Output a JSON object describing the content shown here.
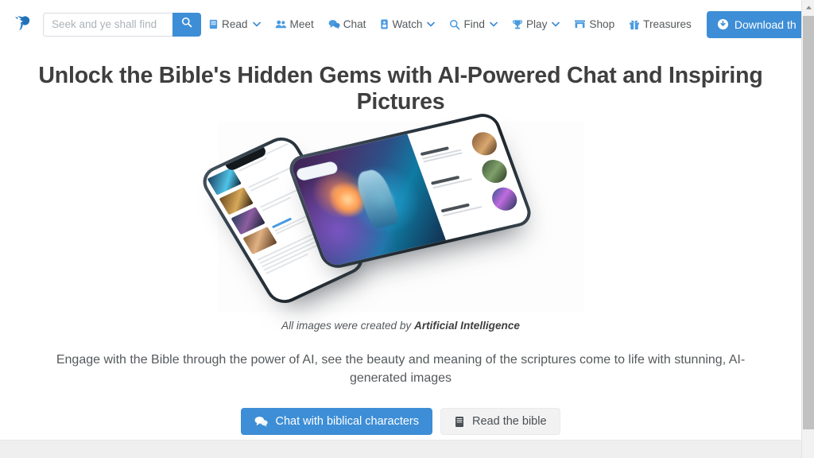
{
  "brand": {
    "logo_icon": "dove-logo-icon",
    "accent_color": "#3d8ed6"
  },
  "search": {
    "placeholder": "Seek and ye shall find",
    "value": "",
    "button_icon": "search-icon"
  },
  "nav": {
    "items": [
      {
        "label": "Read",
        "icon": "book-icon",
        "has_dropdown": true
      },
      {
        "label": "Meet",
        "icon": "users-icon",
        "has_dropdown": false
      },
      {
        "label": "Chat",
        "icon": "comments-icon",
        "has_dropdown": false
      },
      {
        "label": "Watch",
        "icon": "mobile-video-icon",
        "has_dropdown": true
      },
      {
        "label": "Find",
        "icon": "magnifier-icon",
        "has_dropdown": true
      },
      {
        "label": "Play",
        "icon": "trophy-icon",
        "has_dropdown": true
      },
      {
        "label": "Shop",
        "icon": "store-icon",
        "has_dropdown": false
      },
      {
        "label": "Treasures",
        "icon": "gift-icon",
        "has_dropdown": false
      }
    ],
    "download_button": {
      "label": "Download th",
      "icon": "download-circle-icon"
    }
  },
  "hero": {
    "headline": "Unlock the Bible's Hidden Gems with AI-Powered Chat and Inspiring Pictures",
    "caption_prefix": "All images were created by ",
    "caption_emphasis": "Artificial Intelligence",
    "lead": "Engage with the Bible through the power of AI, see the beauty and meaning of the scriptures come to life with stunning, AI-generated images"
  },
  "cta": {
    "primary": {
      "label": "Chat with biblical characters",
      "icon": "comments-icon"
    },
    "secondary": {
      "label": "Read the bible",
      "icon": "book-icon"
    }
  },
  "scrollbar": {
    "up_arrow_icon": "caret-up-icon"
  }
}
